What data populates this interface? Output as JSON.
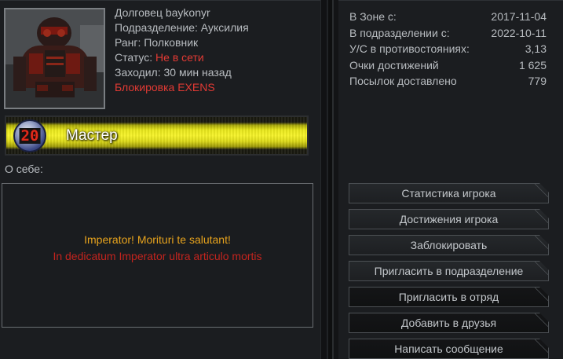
{
  "profile": {
    "name_line": "Долговец baykonyr",
    "division_line": "Подразделение: Ауксилия",
    "rank_line": "Ранг: Полковник",
    "status_label": "Статус: ",
    "status_value": "Не в сети",
    "last_seen": "Заходил: 30 мин назад",
    "block_note": "Блокировка EXENS"
  },
  "rank_bar": {
    "badge_number": "20",
    "title": "Мастер"
  },
  "about": {
    "label": "О себе:",
    "line1": "Imperator! Morituri te salutant!",
    "line2": "In dedicatum Imperator ultra articulo mortis"
  },
  "stats": [
    {
      "label": "В Зоне с:",
      "value": "2017-11-04"
    },
    {
      "label": "В подразделении с:",
      "value": "2022-10-11"
    },
    {
      "label": "У/С в противостояниях:",
      "value": "3,13"
    },
    {
      "label": "Очки достижений",
      "value": "1 625"
    },
    {
      "label": "Посылок доставлено",
      "value": "779"
    }
  ],
  "buttons": [
    {
      "label": "Статистика игрока"
    },
    {
      "label": "Достижения игрока"
    },
    {
      "label": "Заблокировать"
    },
    {
      "label": "Пригласить в подразделение"
    },
    {
      "label": "Пригласить в отряд"
    },
    {
      "label": "Добавить в друзья"
    },
    {
      "label": "Написать сообщение"
    }
  ],
  "colors": {
    "status_red": "#e23a34",
    "about_orange": "#e7a31d",
    "about_red": "#c3241e",
    "rank_bar_yellow": "#f6f32a"
  }
}
